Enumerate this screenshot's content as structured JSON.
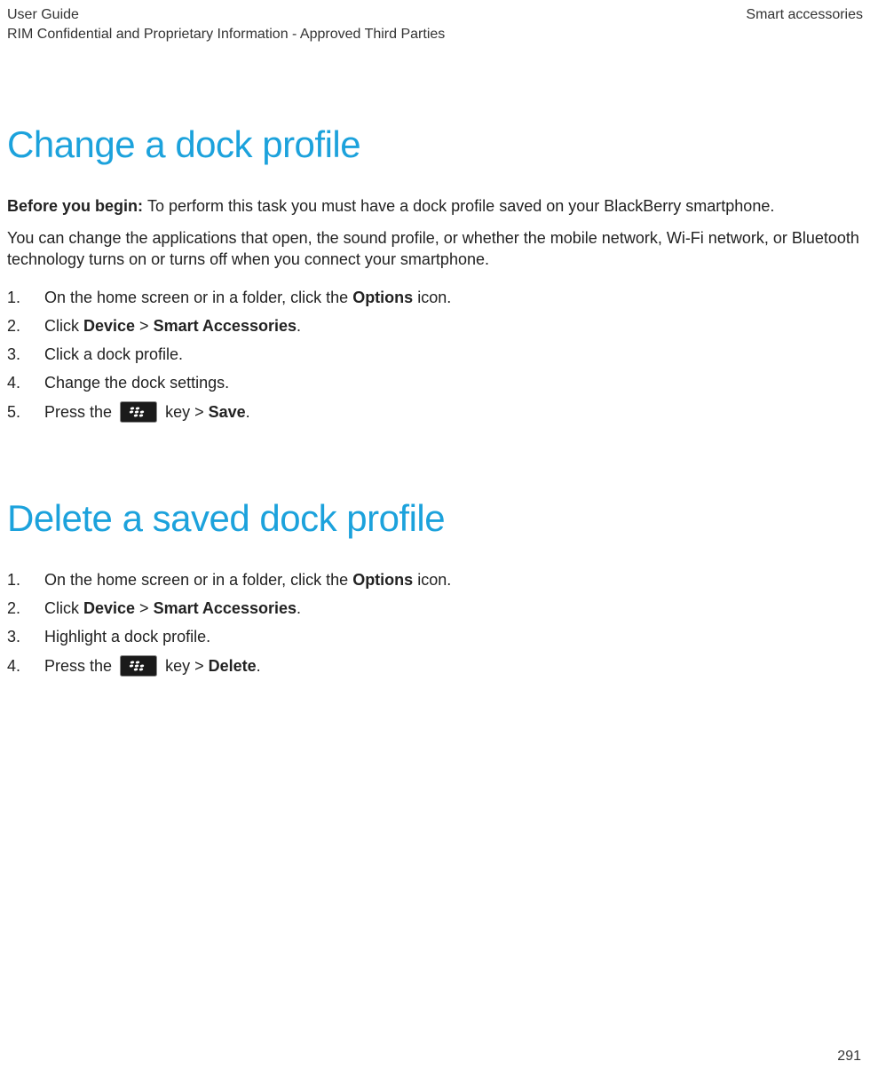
{
  "header": {
    "left_line1": "User Guide",
    "left_line2": "RIM Confidential and Proprietary Information - Approved Third Parties",
    "right": "Smart accessories"
  },
  "section1": {
    "title": "Change a dock profile",
    "before_label": "Before you begin: ",
    "before_text": "To perform this task you must have a dock profile saved on your BlackBerry smartphone.",
    "intro": "You can change the applications that open, the sound profile, or whether the mobile network, Wi-Fi network, or Bluetooth technology turns on or turns off when you connect your smartphone.",
    "steps": {
      "s1_a": "On the home screen or in a folder, click the ",
      "s1_b": "Options",
      "s1_c": " icon.",
      "s2_a": "Click ",
      "s2_b": "Device",
      "s2_c": " > ",
      "s2_d": "Smart Accessories",
      "s2_e": ".",
      "s3": "Click a dock profile.",
      "s4": "Change the dock settings.",
      "s5_a": "Press the ",
      "s5_b": " key > ",
      "s5_c": "Save",
      "s5_d": "."
    }
  },
  "section2": {
    "title": "Delete a saved dock profile",
    "steps": {
      "s1_a": "On the home screen or in a folder, click the ",
      "s1_b": "Options",
      "s1_c": " icon.",
      "s2_a": "Click ",
      "s2_b": "Device",
      "s2_c": " > ",
      "s2_d": "Smart Accessories",
      "s2_e": ".",
      "s3": "Highlight a dock profile.",
      "s4_a": "Press the ",
      "s4_b": " key > ",
      "s4_c": "Delete",
      "s4_d": "."
    }
  },
  "page_number": "291",
  "nums": {
    "n1": "1.",
    "n2": "2.",
    "n3": "3.",
    "n4": "4.",
    "n5": "5."
  }
}
